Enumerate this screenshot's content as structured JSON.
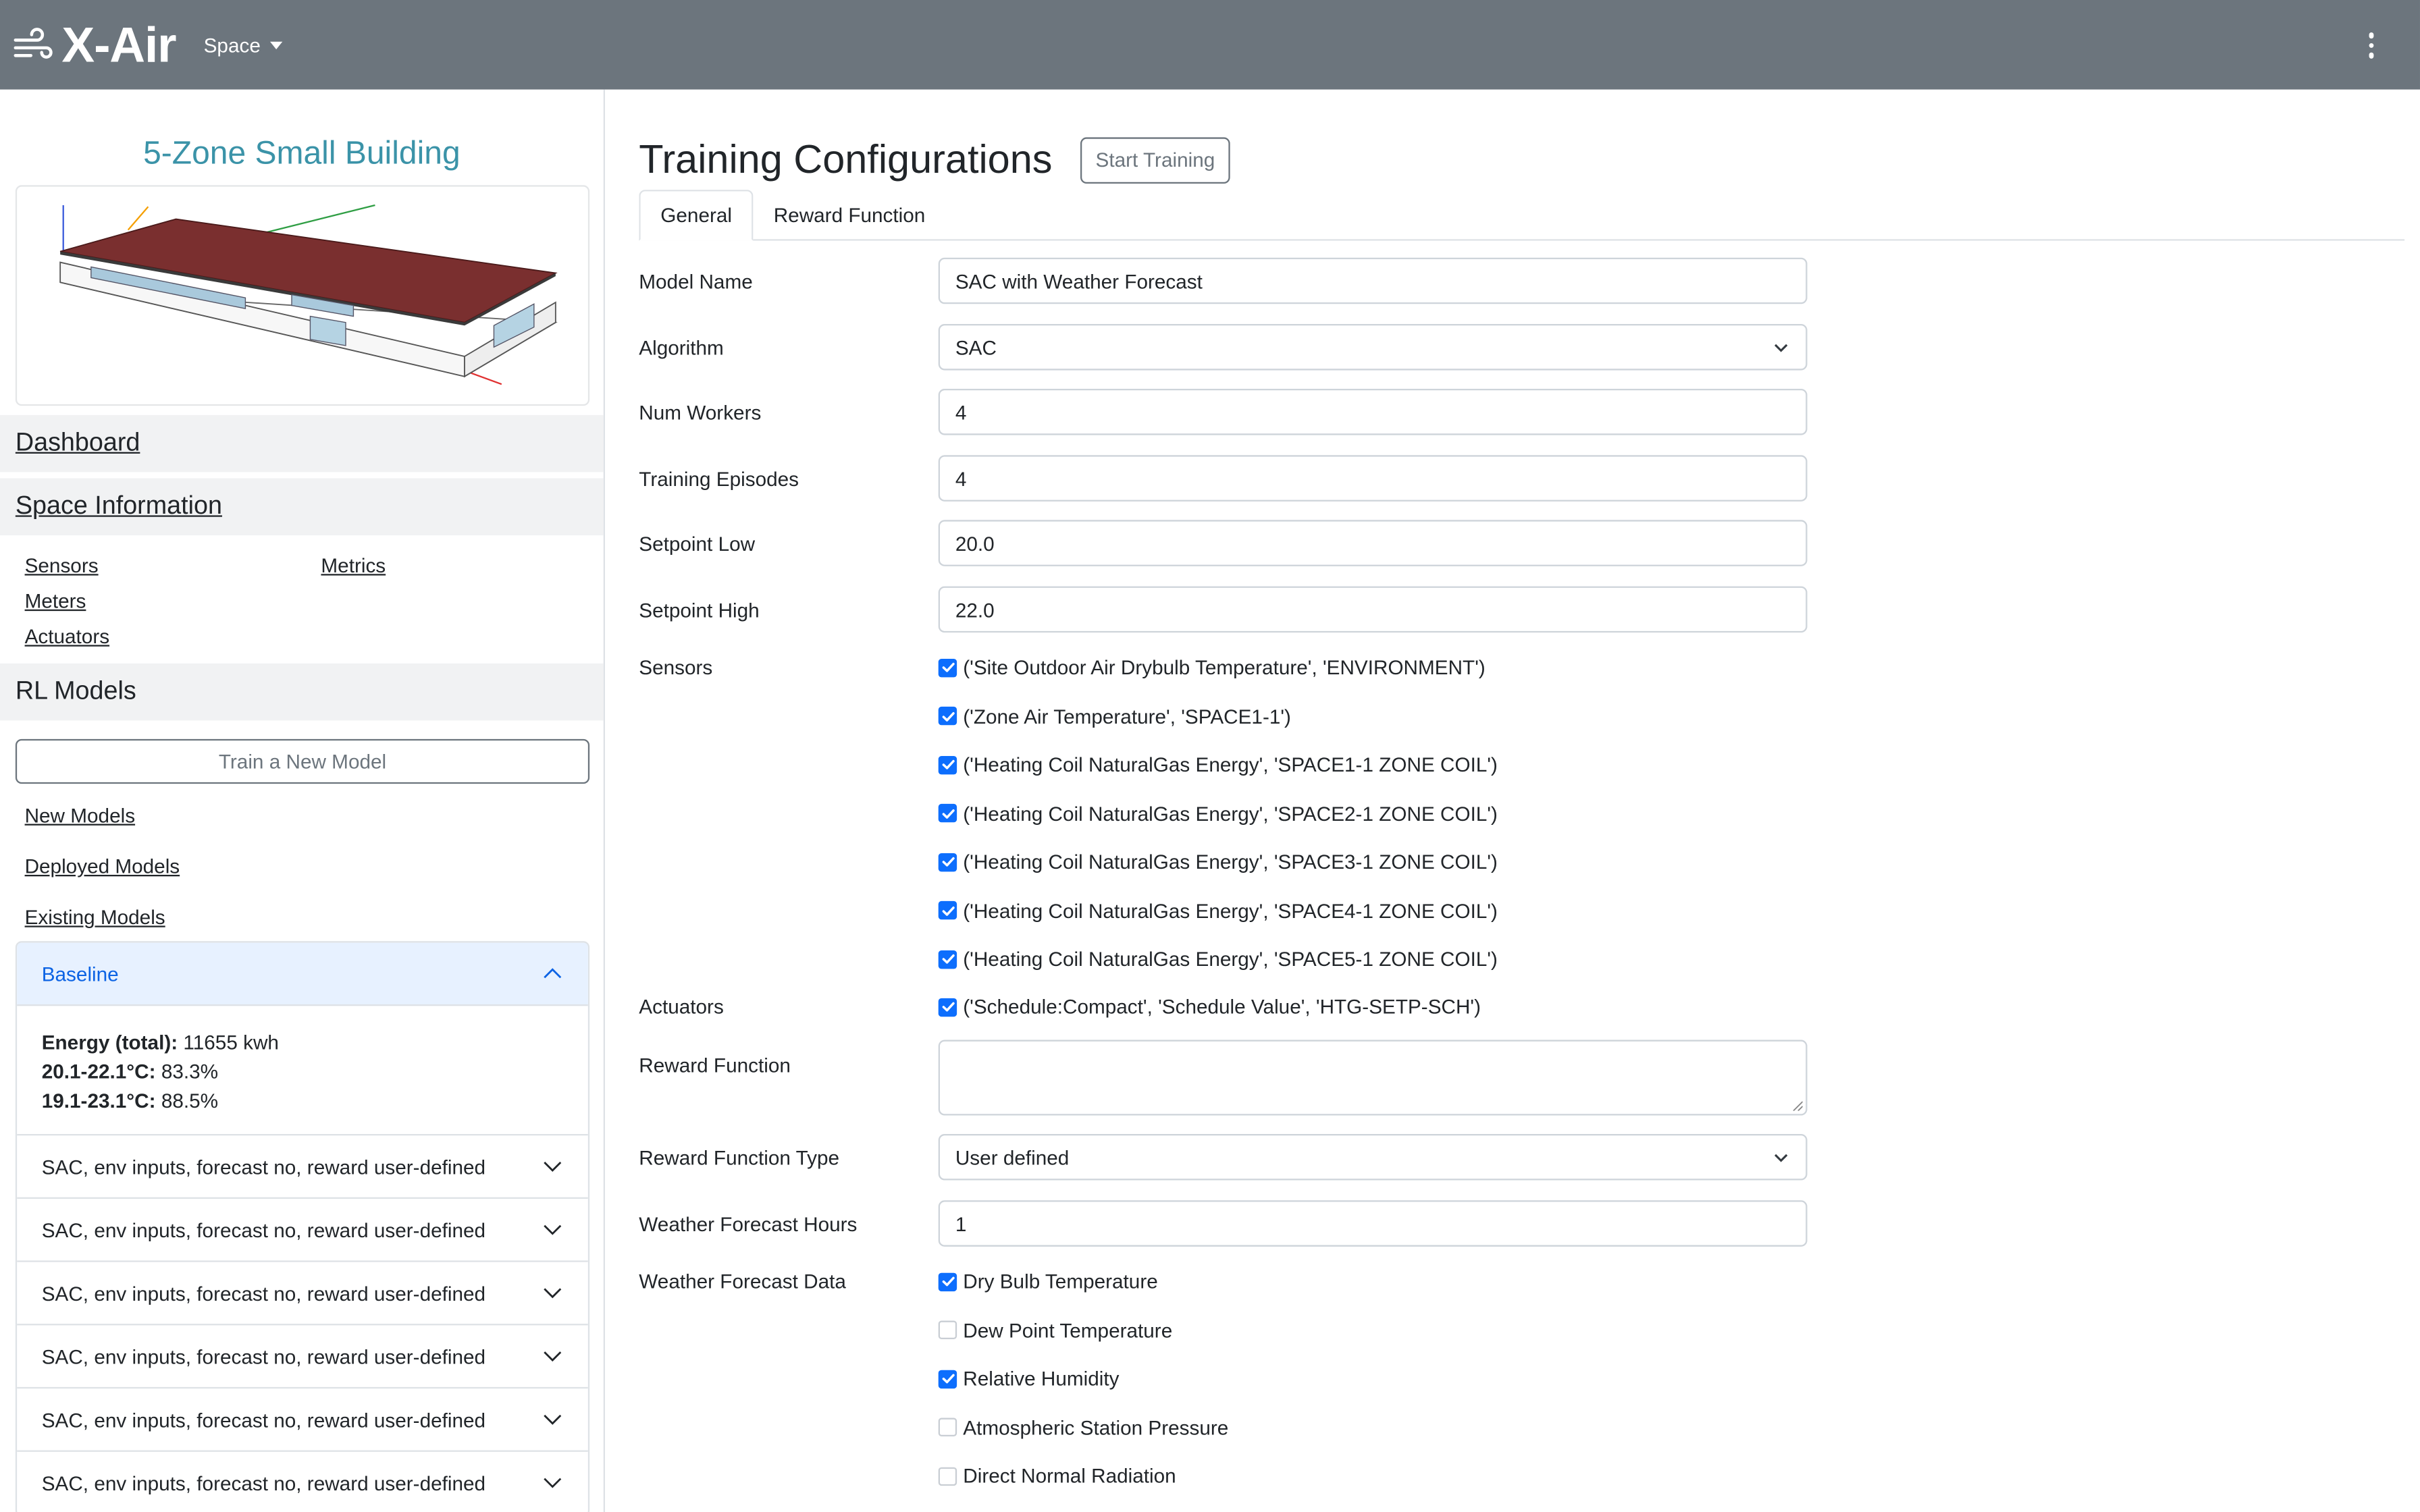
{
  "app": {
    "name": "X-Air",
    "space_menu": "Space"
  },
  "sidebar": {
    "building_title": "5-Zone Small Building",
    "dashboard": "Dashboard",
    "space_information": "Space Information",
    "info_links": [
      "Sensors",
      "Metrics",
      "Meters",
      "Actuators"
    ],
    "rl_models": "RL Models",
    "train_button": "Train a New Model",
    "model_links": [
      "New Models",
      "Deployed Models",
      "Existing Models"
    ],
    "accordion": {
      "baseline": {
        "title": "Baseline",
        "energy_label": "Energy (total):",
        "energy_value": "11655 kwh",
        "band1_label": "20.1-22.1°C:",
        "band1_value": "83.3%",
        "band2_label": "19.1-23.1°C:",
        "band2_value": "88.5%"
      },
      "items": [
        "SAC, env inputs, forecast no, reward user-defined",
        "SAC, env inputs, forecast no, reward user-defined",
        "SAC, env inputs, forecast no, reward user-defined",
        "SAC, env inputs, forecast no, reward user-defined",
        "SAC, env inputs, forecast no, reward user-defined",
        "SAC, env inputs, forecast no, reward user-defined"
      ]
    }
  },
  "main": {
    "title": "Training Configurations",
    "start_button": "Start Training",
    "tabs": [
      "General",
      "Reward Function"
    ],
    "form": {
      "model_name": {
        "label": "Model Name",
        "value": "SAC with Weather Forecast"
      },
      "algorithm": {
        "label": "Algorithm",
        "value": "SAC"
      },
      "num_workers": {
        "label": "Num Workers",
        "value": "4"
      },
      "training_episodes": {
        "label": "Training Episodes",
        "value": "4"
      },
      "setpoint_low": {
        "label": "Setpoint Low",
        "value": "20.0"
      },
      "setpoint_high": {
        "label": "Setpoint High",
        "value": "22.0"
      },
      "sensors_label": "Sensors",
      "sensors": [
        {
          "text": "('Site Outdoor Air Drybulb Temperature', 'ENVIRONMENT')",
          "checked": true
        },
        {
          "text": "('Zone Air Temperature', 'SPACE1-1')",
          "checked": true
        },
        {
          "text": "('Heating Coil NaturalGas Energy', 'SPACE1-1 ZONE COIL')",
          "checked": true
        },
        {
          "text": "('Heating Coil NaturalGas Energy', 'SPACE2-1 ZONE COIL')",
          "checked": true
        },
        {
          "text": "('Heating Coil NaturalGas Energy', 'SPACE3-1 ZONE COIL')",
          "checked": true
        },
        {
          "text": "('Heating Coil NaturalGas Energy', 'SPACE4-1 ZONE COIL')",
          "checked": true
        },
        {
          "text": "('Heating Coil NaturalGas Energy', 'SPACE5-1 ZONE COIL')",
          "checked": true
        }
      ],
      "actuators_label": "Actuators",
      "actuators": [
        {
          "text": "('Schedule:Compact', 'Schedule Value', 'HTG-SETP-SCH')",
          "checked": true
        }
      ],
      "reward_function": {
        "label": "Reward Function",
        "value": ""
      },
      "reward_function_type": {
        "label": "Reward Function Type",
        "value": "User defined"
      },
      "weather_forecast_hours": {
        "label": "Weather Forecast Hours",
        "value": "1"
      },
      "weather_forecast_data_label": "Weather Forecast Data",
      "weather_forecast_data": [
        {
          "text": "Dry Bulb Temperature",
          "checked": true
        },
        {
          "text": "Dew Point Temperature",
          "checked": false
        },
        {
          "text": "Relative Humidity",
          "checked": true
        },
        {
          "text": "Atmospheric Station Pressure",
          "checked": false
        },
        {
          "text": "Direct Normal Radiation",
          "checked": false
        }
      ]
    }
  },
  "colors": {
    "topbar": "#6c757d",
    "accent_title": "#3b93a8",
    "checkbox": "#0d6efd",
    "accordion_active_bg": "#e7f1ff",
    "accordion_active_text": "#0c63e4"
  }
}
